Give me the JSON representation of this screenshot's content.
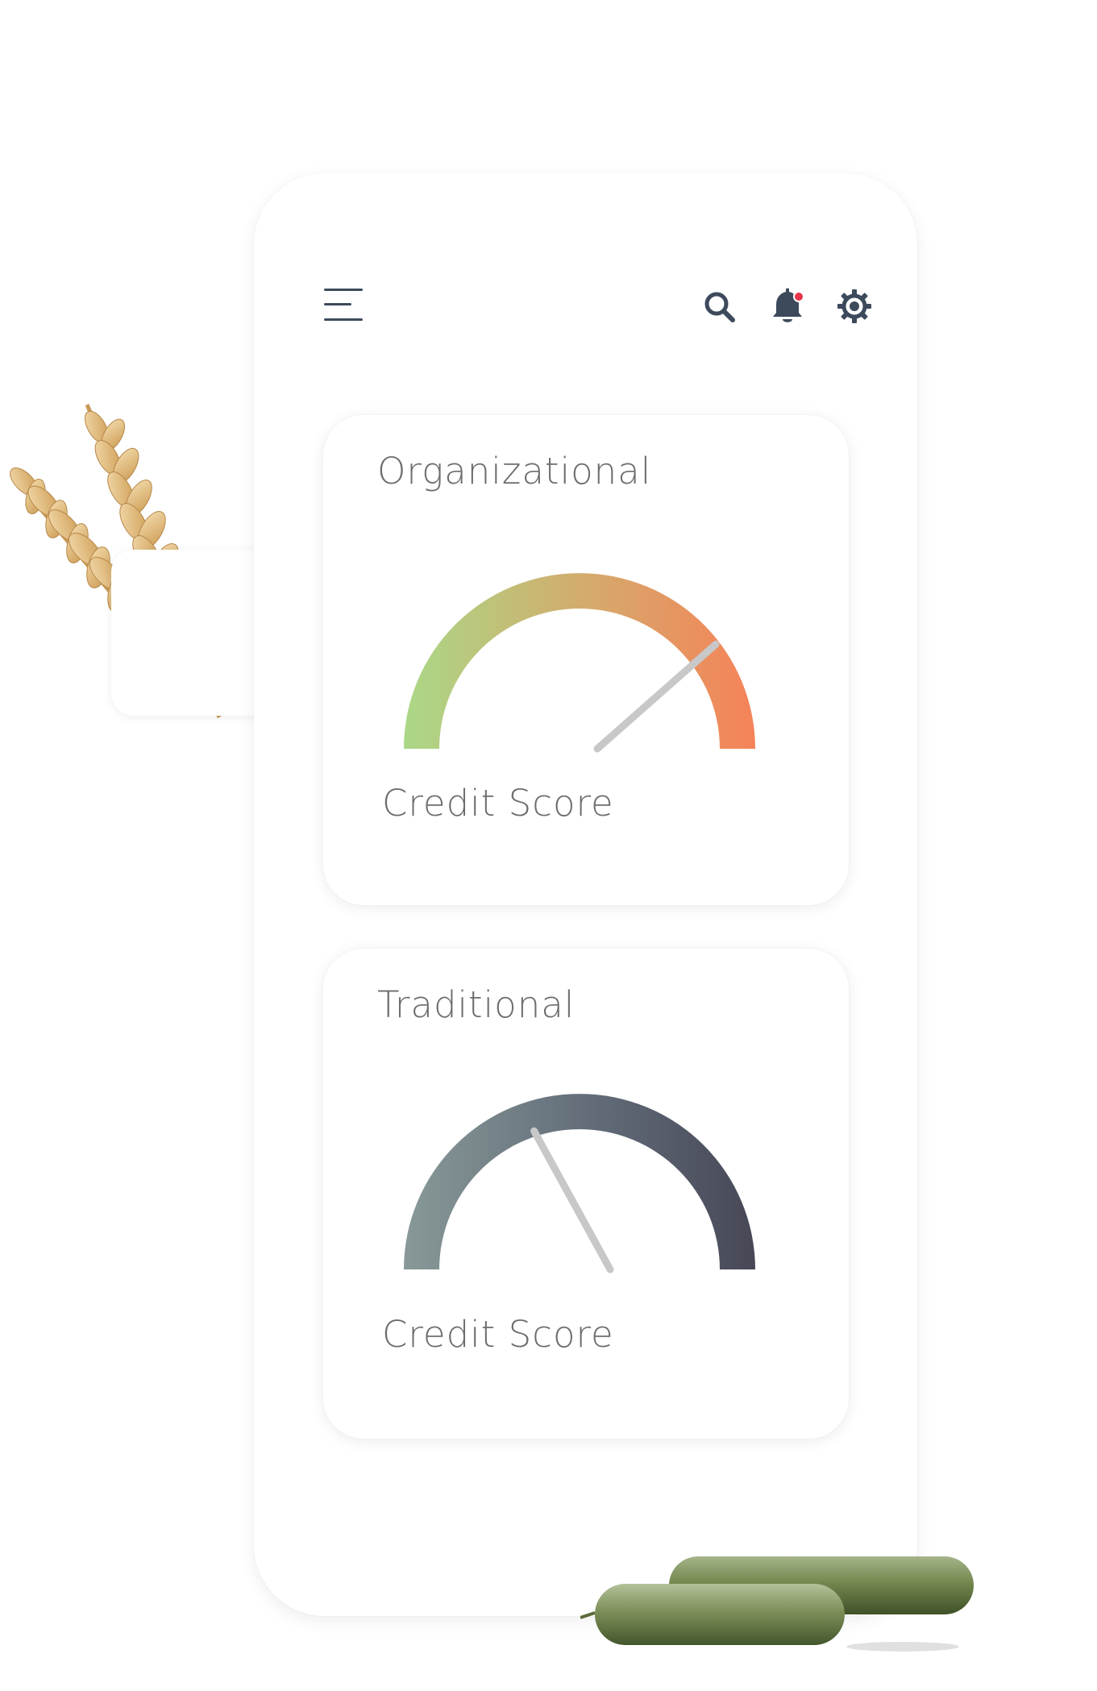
{
  "header": {
    "menu_icon": "hamburger-menu-icon",
    "search_icon": "search-icon",
    "notification_icon": "bell-icon",
    "notification_badge_color": "#e8344a",
    "settings_icon": "gear-icon",
    "icon_color": "#3d4a5c"
  },
  "cards": [
    {
      "title": "Organizational",
      "subtitle": "Credit Score",
      "gauge_colors": [
        "#aad887",
        "#d6a86a",
        "#fd7a55"
      ],
      "needle_level": 0.77
    },
    {
      "title": "Traditional",
      "subtitle": "Credit Score",
      "gauge_colors": [
        "#889998",
        "#616b78",
        "#41404f"
      ],
      "needle_level": 0.34
    }
  ],
  "decorations": {
    "wheat": "wheat-image",
    "cucumbers": "cucumber-image"
  }
}
